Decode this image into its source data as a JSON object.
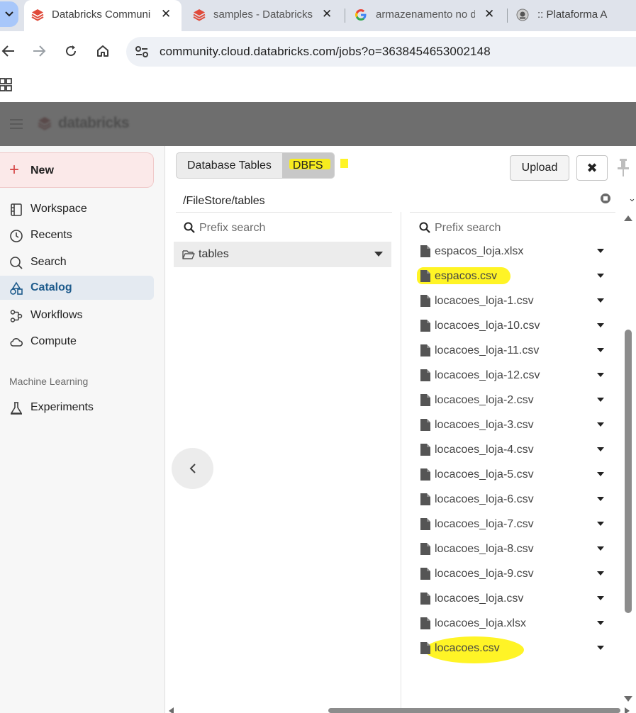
{
  "browser": {
    "tabs": [
      {
        "title": "Databricks Communi",
        "active": true,
        "icon": "databricks-logo-icon"
      },
      {
        "title": "samples - Databricks",
        "active": false,
        "icon": "databricks-logo-icon"
      },
      {
        "title": "armazenamento no d",
        "active": false,
        "icon": "google-logo-icon"
      },
      {
        "title": ":: Plataforma A",
        "active": false,
        "icon": "site-crest-icon"
      }
    ],
    "url": "community.cloud.databricks.com/jobs?o=3638454653002148"
  },
  "header": {
    "logo_text": "databricks"
  },
  "sidebar": {
    "new_label": "New",
    "items": [
      {
        "label": "Workspace",
        "icon": "workspace-icon",
        "active": false
      },
      {
        "label": "Recents",
        "icon": "clock-icon",
        "active": false
      },
      {
        "label": "Search",
        "icon": "search-icon",
        "active": false
      },
      {
        "label": "Catalog",
        "icon": "catalog-icon",
        "active": true
      },
      {
        "label": "Workflows",
        "icon": "workflows-icon",
        "active": false
      },
      {
        "label": "Compute",
        "icon": "cloud-icon",
        "active": false
      }
    ],
    "section_ml": "Machine Learning",
    "ml_items": [
      {
        "label": "Experiments",
        "icon": "flask-icon",
        "active": false
      }
    ]
  },
  "dbfs": {
    "tabs": [
      {
        "label": "Database Tables",
        "selected": false
      },
      {
        "label": "DBFS",
        "selected": true
      }
    ],
    "upload_label": "Upload",
    "close_label": "✖",
    "path": "/FileStore/tables",
    "left_search_placeholder": "Prefix search",
    "right_search_placeholder": "Prefix search",
    "folder": "tables",
    "files": [
      {
        "name": "espacos_loja.xlsx",
        "highlighted": false
      },
      {
        "name": "espacos.csv",
        "highlighted": true
      },
      {
        "name": "locacoes_loja-1.csv",
        "highlighted": false
      },
      {
        "name": "locacoes_loja-10.csv",
        "highlighted": false
      },
      {
        "name": "locacoes_loja-11.csv",
        "highlighted": false
      },
      {
        "name": "locacoes_loja-12.csv",
        "highlighted": false
      },
      {
        "name": "locacoes_loja-2.csv",
        "highlighted": false
      },
      {
        "name": "locacoes_loja-3.csv",
        "highlighted": false
      },
      {
        "name": "locacoes_loja-4.csv",
        "highlighted": false
      },
      {
        "name": "locacoes_loja-5.csv",
        "highlighted": false
      },
      {
        "name": "locacoes_loja-6.csv",
        "highlighted": false
      },
      {
        "name": "locacoes_loja-7.csv",
        "highlighted": false
      },
      {
        "name": "locacoes_loja-8.csv",
        "highlighted": false
      },
      {
        "name": "locacoes_loja-9.csv",
        "highlighted": false
      },
      {
        "name": "locacoes_loja.csv",
        "highlighted": false
      },
      {
        "name": "locacoes_loja.xlsx",
        "highlighted": false
      },
      {
        "name": "locacoes.csv",
        "highlighted": true
      }
    ]
  },
  "colors": {
    "highlight": "#fff200",
    "databricks_red": "#e04a3a",
    "catalog_active": "#1e5b8c"
  }
}
